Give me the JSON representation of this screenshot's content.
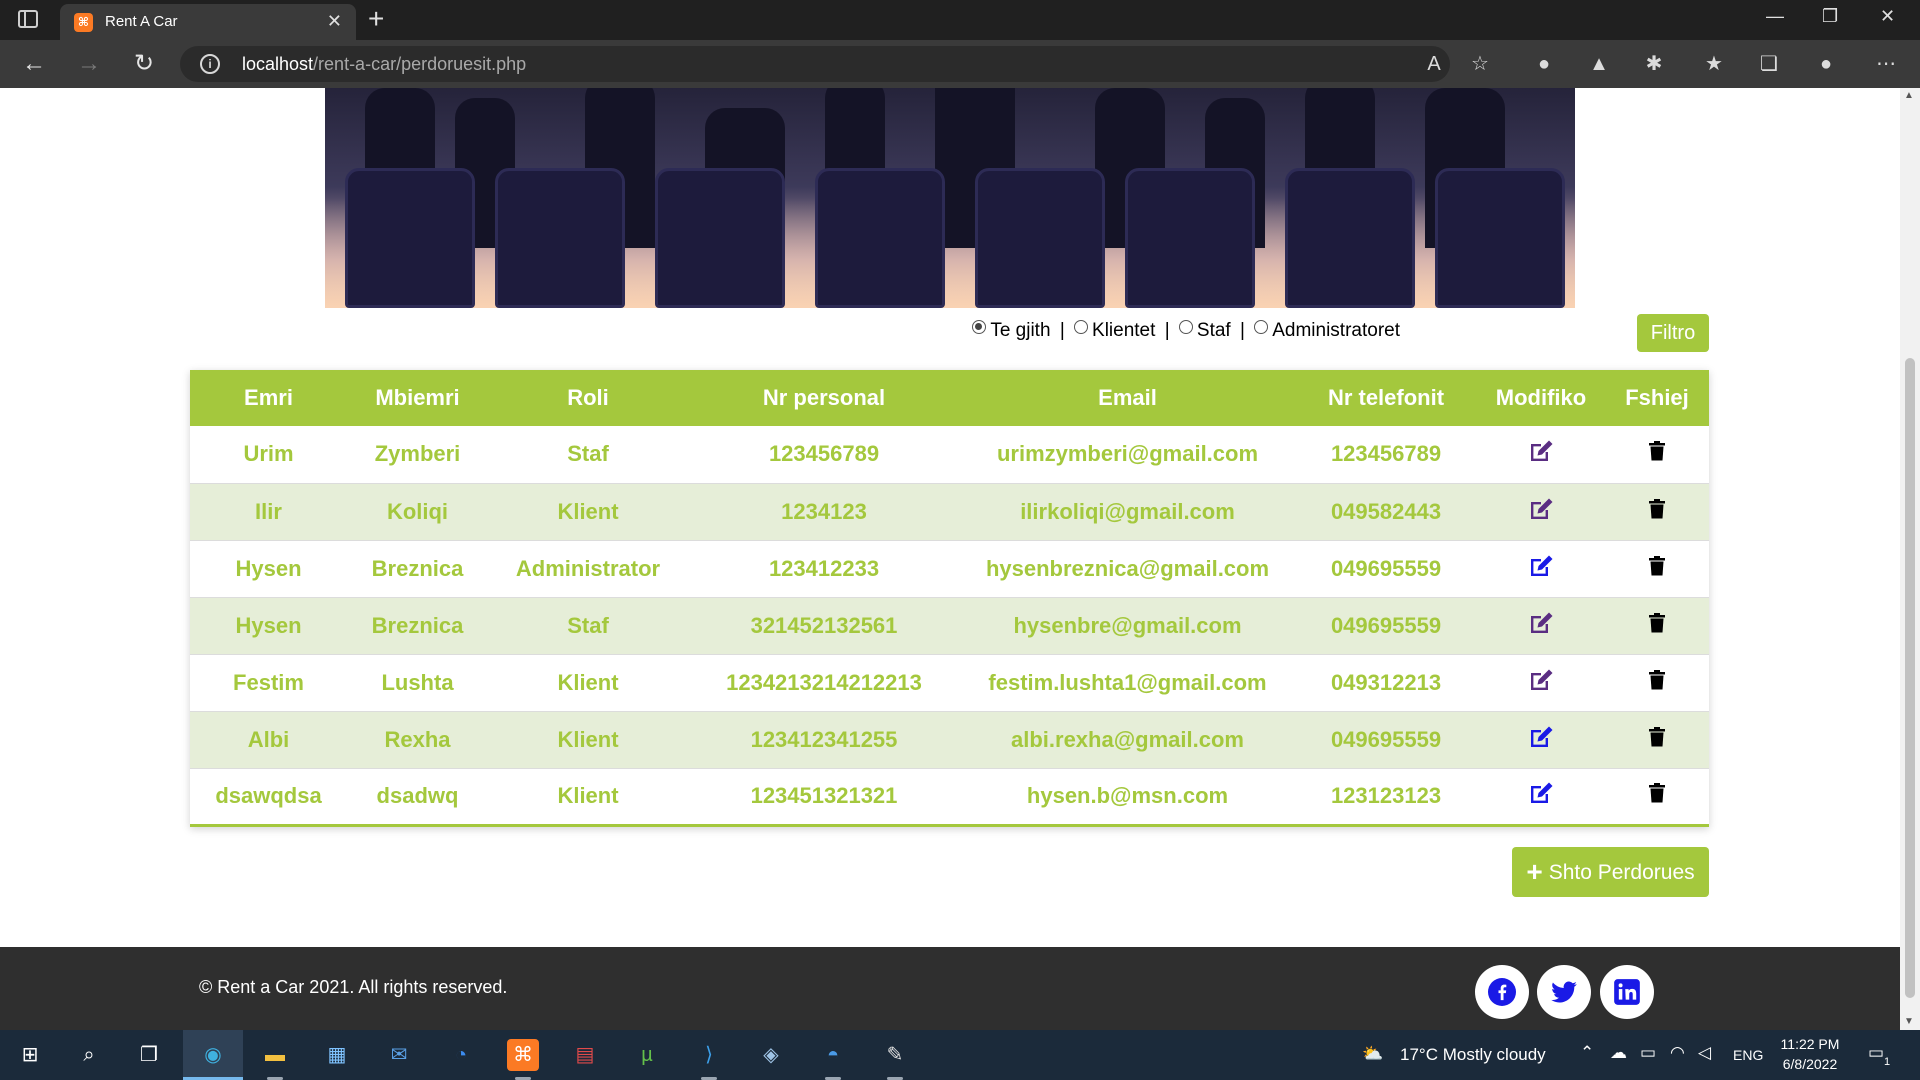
{
  "browser": {
    "tab_title": "Rent A Car",
    "tab_favicon": "xampp-icon",
    "url_host": "localhost",
    "url_path": "/rent-a-car/perdoruesit.php"
  },
  "filter": {
    "options": [
      "Te gjith",
      "Klientet",
      "Staf",
      "Administratoret"
    ],
    "selected": "Te gjith",
    "separator": "|",
    "button_label": "Filtro"
  },
  "table": {
    "columns": [
      "Emri",
      "Mbiemri",
      "Roli",
      "Nr personal",
      "Email",
      "Nr telefonit",
      "Modifiko",
      "Fshiej"
    ],
    "rows": [
      [
        "Urim",
        "Zymberi",
        "Staf",
        "123456789",
        "urimzymberi@gmail.com",
        "123456789"
      ],
      [
        "Ilir",
        "Koliqi",
        "Klient",
        "1234123",
        "ilirkoliqi@gmail.com",
        "049582443"
      ],
      [
        "Hysen",
        "Breznica",
        "Administrator",
        "123412233",
        "hysenbreznica@gmail.com",
        "049695559"
      ],
      [
        "Hysen",
        "Breznica",
        "Staf",
        "321452132561",
        "hysenbre@gmail.com",
        "049695559"
      ],
      [
        "Festim",
        "Lushta",
        "Klient",
        "1234213214212213",
        "festim.lushta1@gmail.com",
        "049312213"
      ],
      [
        "Albi",
        "Rexha",
        "Klient",
        "123412341255",
        "albi.rexha@gmail.com",
        "049695559"
      ],
      [
        "dsawqdsa",
        "dsadwq",
        "Klient",
        "123451321321",
        "hysen.b@msn.com",
        "123123123"
      ]
    ],
    "edit_icon_colors": [
      "#5a2d82",
      "#5a2d82",
      "#1a1ae6",
      "#5a2d82",
      "#5a2d82",
      "#1a1ae6",
      "#1a1ae6"
    ]
  },
  "add_button": {
    "plus": "+",
    "label": "Shto Perdorues"
  },
  "footer": {
    "copyright": "© Rent a Car 2021. All rights reserved.",
    "social": [
      "facebook-icon",
      "twitter-icon",
      "linkedin-icon"
    ]
  },
  "taskbar": {
    "weather": "17°C  Mostly cloudy",
    "language": "ENG",
    "time": "11:22 PM",
    "date": "6/8/2022",
    "notifications": "1"
  },
  "colors": {
    "accent_green": "#a4c83d",
    "footer_bg": "#2f2f2f",
    "social_blue": "#1a1ae6"
  }
}
